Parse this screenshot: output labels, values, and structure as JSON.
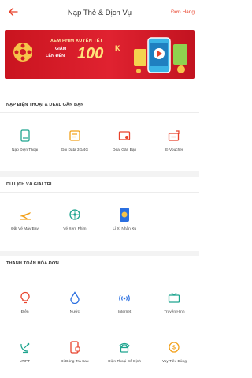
{
  "header": {
    "back_icon": "arrow-left-icon",
    "title": "Nạp Thẻ & Dịch Vụ",
    "orders_link": "Đơn Hàng"
  },
  "banner": {
    "line1": "XEM PHIM XUYÊN TẾT",
    "line2": "GIẢM",
    "line3": "LÊN ĐẾN",
    "amount": "100",
    "unit": "K"
  },
  "sections": [
    {
      "title": "NẠP ĐIỆN THOẠI & DEAL GẦN BẠN",
      "items": [
        {
          "label": "Nạp Điện Thoại",
          "icon": "phone-icon"
        },
        {
          "label": "Gói Data 3G/4G",
          "icon": "data-package-icon"
        },
        {
          "label": "Deal Gần Bạn",
          "icon": "ticket-icon"
        },
        {
          "label": "E-Voucher",
          "icon": "voucher-icon"
        }
      ]
    },
    {
      "title": "DU LỊCH VÀ GIẢI TRÍ",
      "items": [
        {
          "label": "Đặt Vé Máy Bay",
          "icon": "airplane-icon"
        },
        {
          "label": "Vé Xem Phim",
          "icon": "movie-icon"
        },
        {
          "label": "Lì Xì Nhận Xu",
          "icon": "red-envelope-icon"
        }
      ]
    },
    {
      "title": "THANH TOÁN HÓA ĐƠN",
      "items": [
        {
          "label": "Điện",
          "icon": "lightbulb-icon"
        },
        {
          "label": "Nước",
          "icon": "water-drop-icon"
        },
        {
          "label": "Internet",
          "icon": "wifi-icon"
        },
        {
          "label": "Truyền Hình",
          "icon": "tv-icon"
        },
        {
          "label": "VNPT",
          "icon": "satellite-icon"
        },
        {
          "label": "Di Động Trả Sau",
          "icon": "mobile-postpaid-icon"
        },
        {
          "label": "Điện Thoại Cố Định",
          "icon": "landline-phone-icon"
        },
        {
          "label": "Vay Tiêu Dùng",
          "icon": "loan-coin-icon"
        }
      ]
    }
  ],
  "colors": {
    "accent": "#e8412a",
    "icon_red": "#e8412a",
    "icon_teal": "#1fa58f",
    "icon_blue": "#2a6fe0",
    "icon_orange": "#f2a11b",
    "banner_red": "#d11a26"
  }
}
